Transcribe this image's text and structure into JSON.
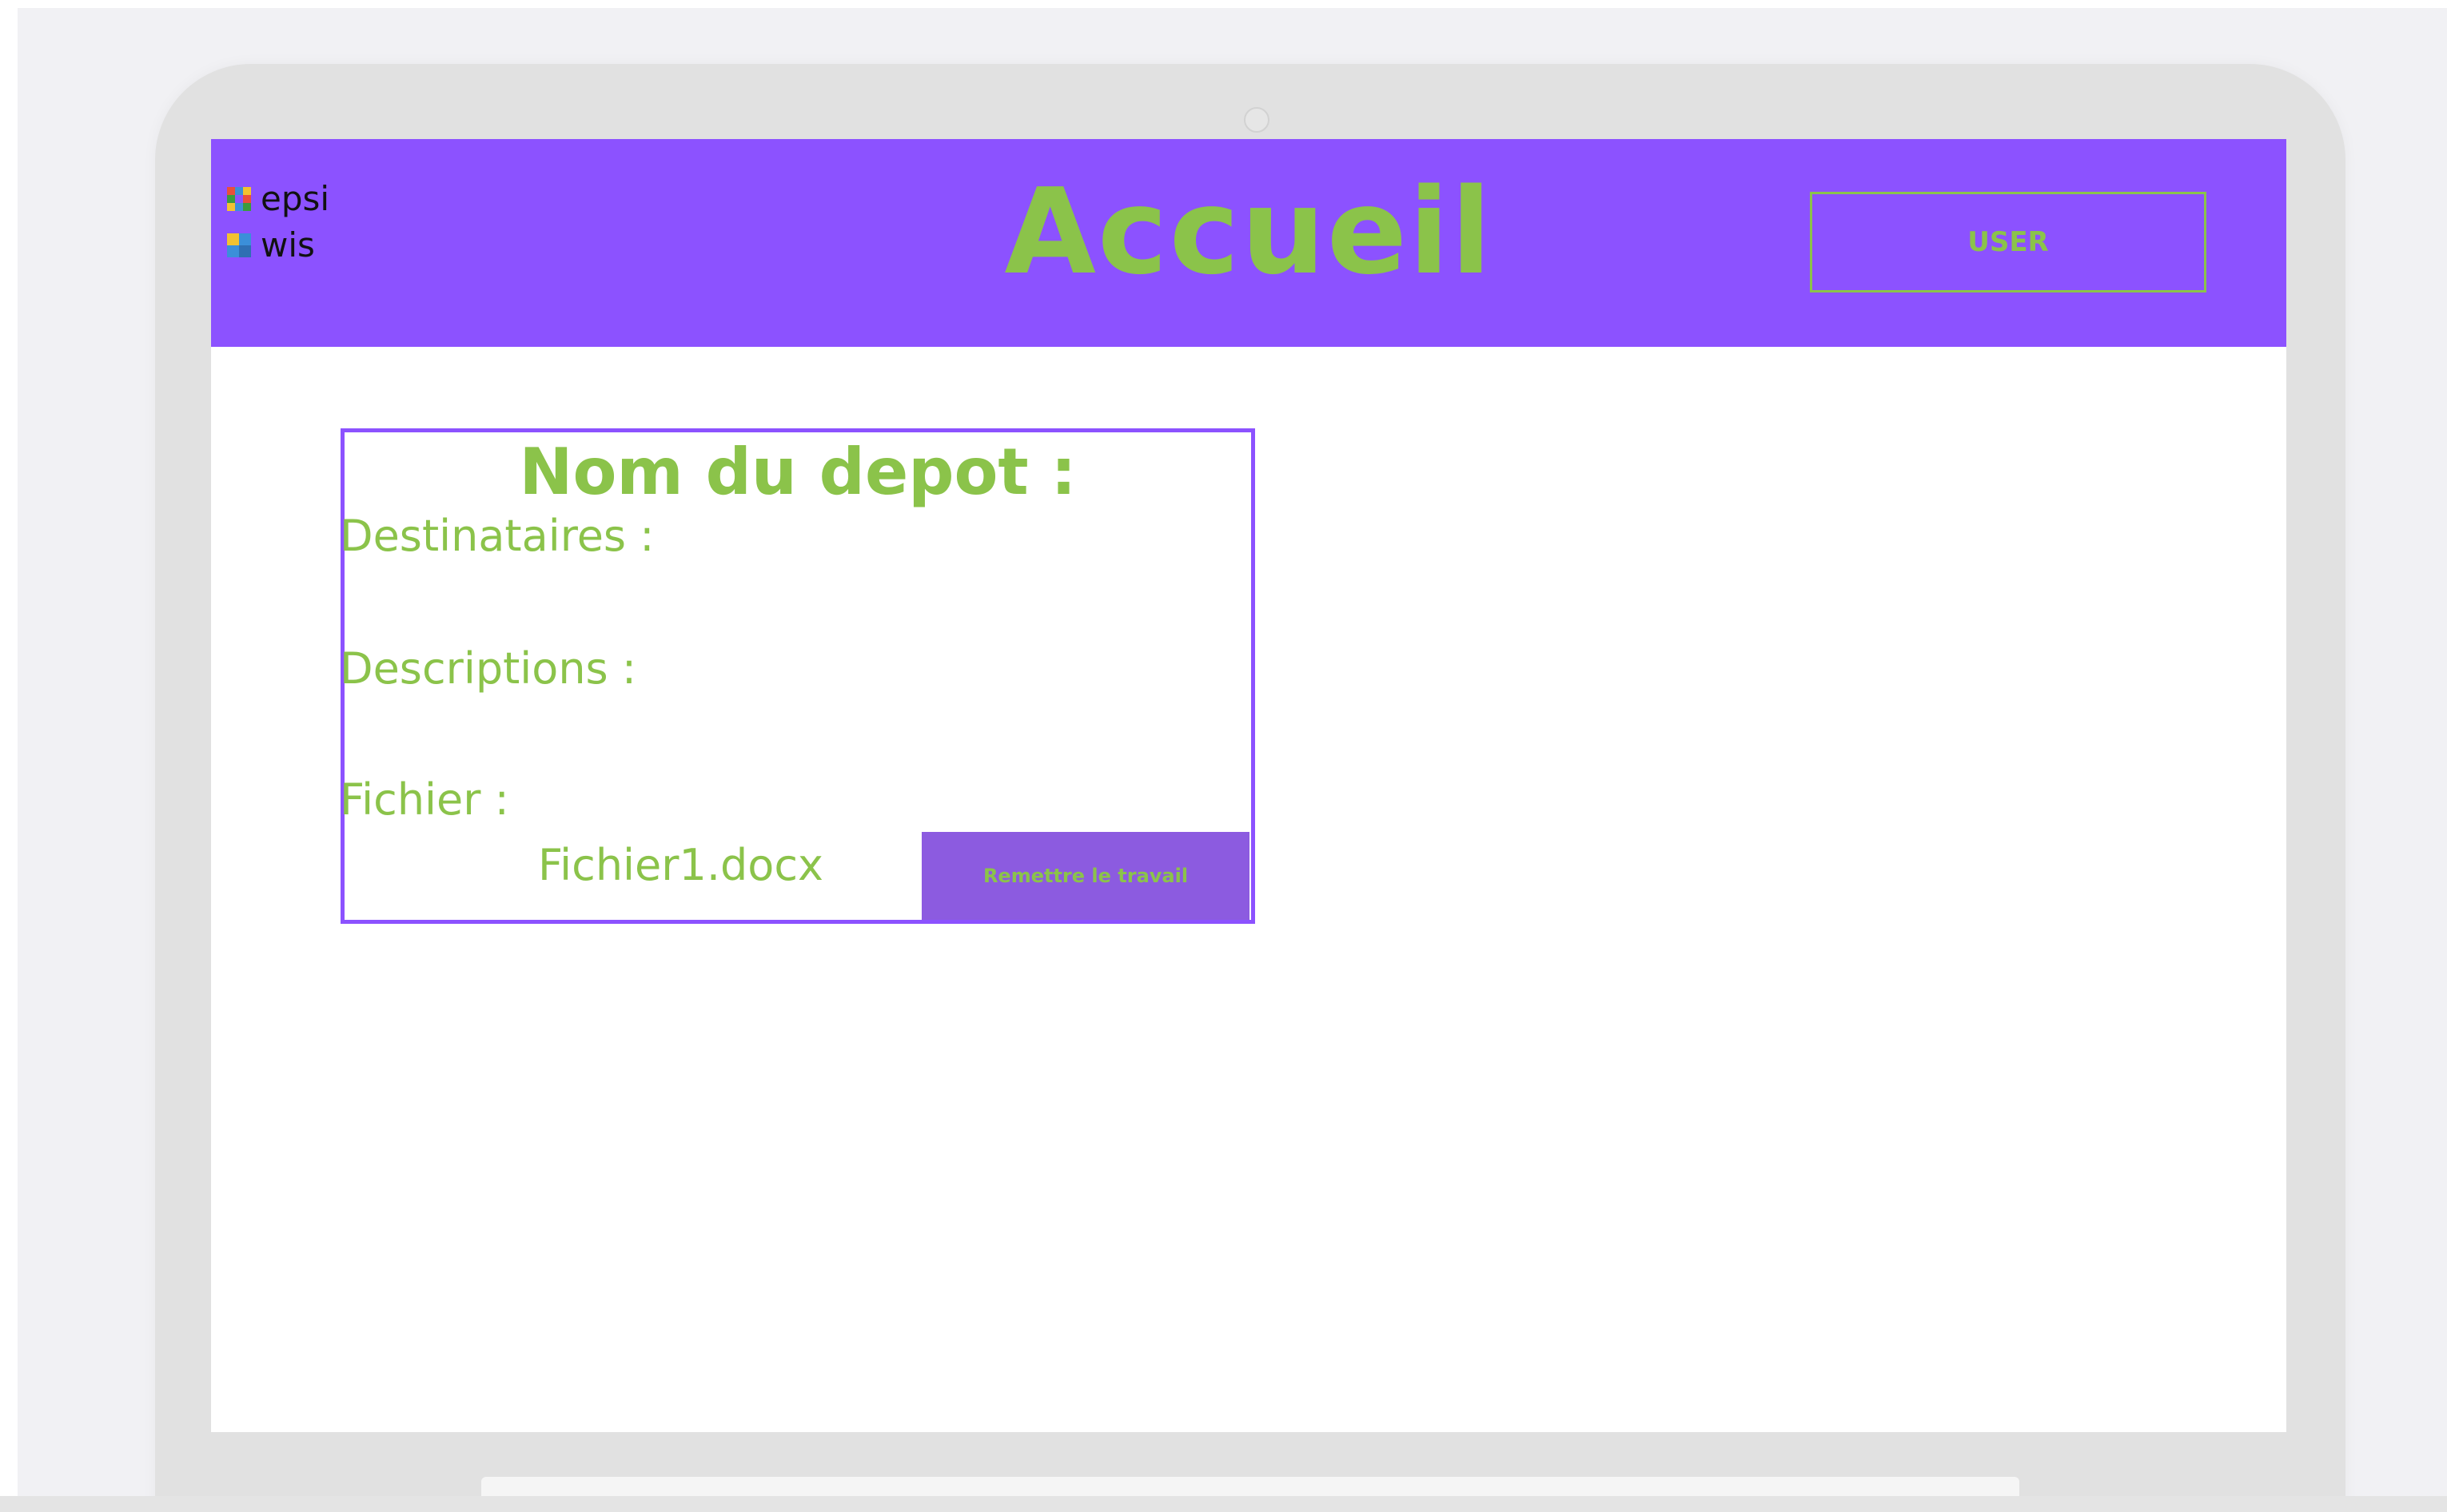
{
  "header": {
    "logo_line1": "epsi",
    "logo_line2": "wis",
    "title": "Accueil",
    "user_label": "USER"
  },
  "depot_card": {
    "title": "Nom du depot :",
    "recipients_label": "Destinataires :",
    "description_label": "Descriptions :",
    "file_label": "Fichier :",
    "file_name": "Fichier1.docx",
    "submit_label": "Remettre le travail"
  },
  "colors": {
    "header_bg": "#8c52ff",
    "accent_green": "#8bc34a",
    "card_border": "#8c52ff",
    "button_bg": "#8c5be0"
  },
  "icons": {
    "logo_mark_1": "epsi-logo-mark",
    "logo_mark_2": "wis-logo-mark"
  }
}
